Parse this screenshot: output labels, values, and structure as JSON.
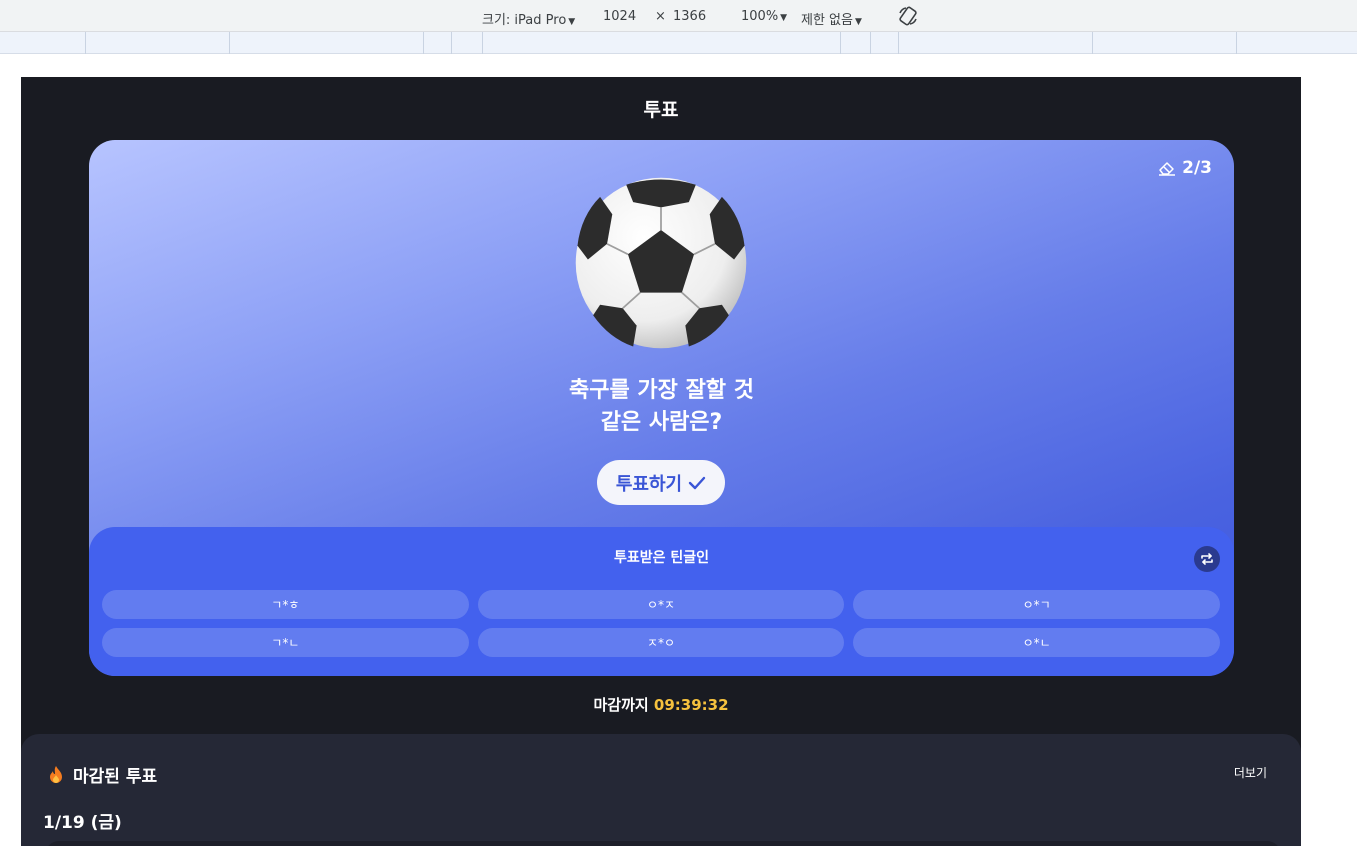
{
  "devtools": {
    "device_label": "크기: iPad Pro",
    "width": "1024",
    "times": "×",
    "height": "1366",
    "zoom": "100%",
    "throttle": "제한 없음"
  },
  "header": {
    "title": "투표"
  },
  "vote": {
    "progress": "2/3",
    "question_line1": "축구를 가장 잘할 것",
    "question_line2": "같은 사람은?",
    "vote_button_label": "투표하기",
    "voters_title": "투표받은 틴글인",
    "voters": [
      "ㄱ*ㅎ",
      "ㅇ*ㅈ",
      "ㅇ*ㄱ",
      "ㄱ*ㄴ",
      "ㅈ*ㅇ",
      "ㅇ*ㄴ"
    ],
    "icon": "soccer-ball"
  },
  "deadline": {
    "label": "마감까지",
    "time": "09:39:32"
  },
  "closed": {
    "title": "마감된 투표",
    "more_label": "더보기",
    "date": "1/19 (금)"
  },
  "colors": {
    "accent": "#4361ee",
    "deadline_time": "#f6c23e",
    "background": "#191b22"
  }
}
